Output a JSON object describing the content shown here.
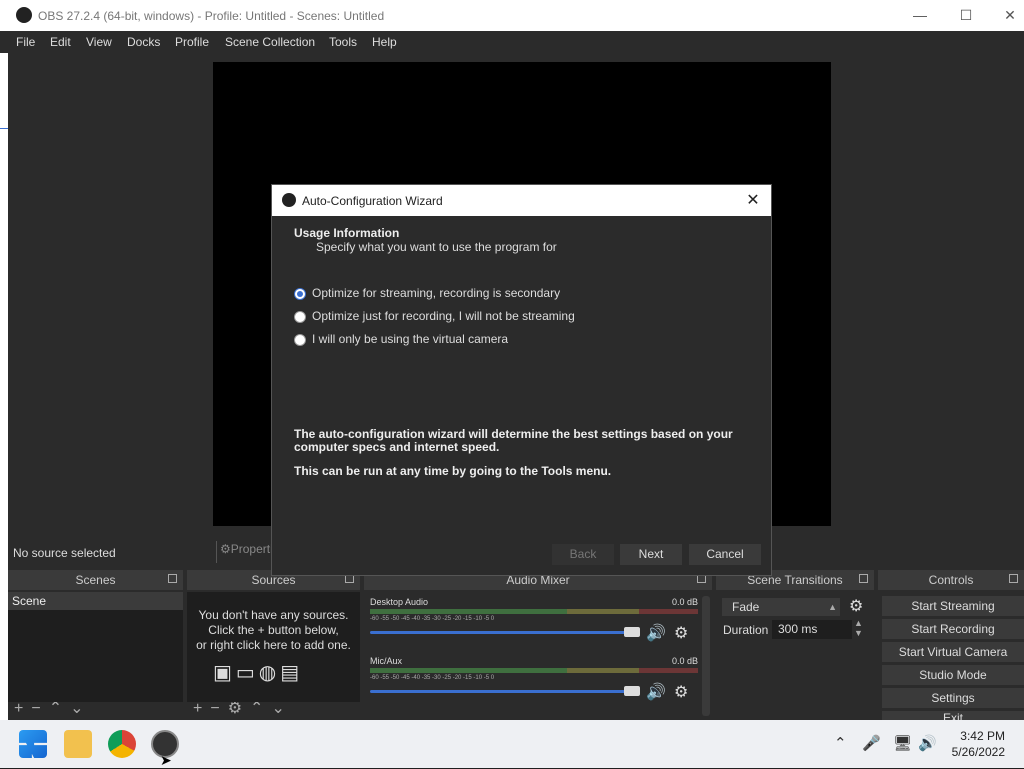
{
  "window": {
    "title": "OBS 27.2.4 (64-bit, windows) - Profile: Untitled - Scenes: Untitled",
    "minimize": "—",
    "maximize": "☐",
    "close": "✕"
  },
  "menu": [
    "File",
    "Edit",
    "View",
    "Docks",
    "Profile",
    "Scene Collection",
    "Tools",
    "Help"
  ],
  "context_bar": {
    "no_source": "No source selected",
    "properties": "⚙Properties"
  },
  "docks": {
    "scenes": {
      "title": "Scenes",
      "items": [
        "Scene"
      ]
    },
    "sources": {
      "title": "Sources",
      "hint_lines": [
        "You don't have any sources.",
        "Click the + button below,",
        "or right click here to add one."
      ]
    },
    "mixer": {
      "title": "Audio Mixer",
      "tracks": [
        {
          "name": "Desktop Audio",
          "db": "0.0 dB"
        },
        {
          "name": "Mic/Aux",
          "db": "0.0 dB"
        }
      ],
      "scale": "-60 -55 -50 -45 -40 -35 -30 -25 -20 -15 -10 -5 0"
    },
    "transitions": {
      "title": "Scene Transitions",
      "selected": "Fade",
      "duration_label": "Duration",
      "duration_value": "300 ms"
    },
    "controls": {
      "title": "Controls",
      "buttons": [
        "Start Streaming",
        "Start Recording",
        "Start Virtual Camera",
        "Studio Mode",
        "Settings",
        "Exit"
      ]
    }
  },
  "dialog": {
    "title": "Auto-Configuration Wizard",
    "heading": "Usage Information",
    "subheading": "Specify what you want to use the program for",
    "options": [
      {
        "label": "Optimize for streaming, recording is secondary",
        "selected": true
      },
      {
        "label": "Optimize just for recording, I will not be streaming",
        "selected": false
      },
      {
        "label": "I will only be using the virtual camera",
        "selected": false
      }
    ],
    "info1": "The auto-configuration wizard will determine the best settings based on your computer specs and internet speed.",
    "info2": "This can be run at any time by going to the Tools menu.",
    "buttons": {
      "back": "Back",
      "next": "Next",
      "cancel": "Cancel"
    }
  },
  "taskbar": {
    "time": "3:42 PM",
    "date": "5/26/2022",
    "apps": [
      "start-icon",
      "file-explorer-icon",
      "chrome-icon",
      "obs-icon"
    ]
  },
  "colors": {
    "accent": "#3a6fd0",
    "dock_bg": "#2b2b2b",
    "panel_bg": "#1e1e1e"
  }
}
